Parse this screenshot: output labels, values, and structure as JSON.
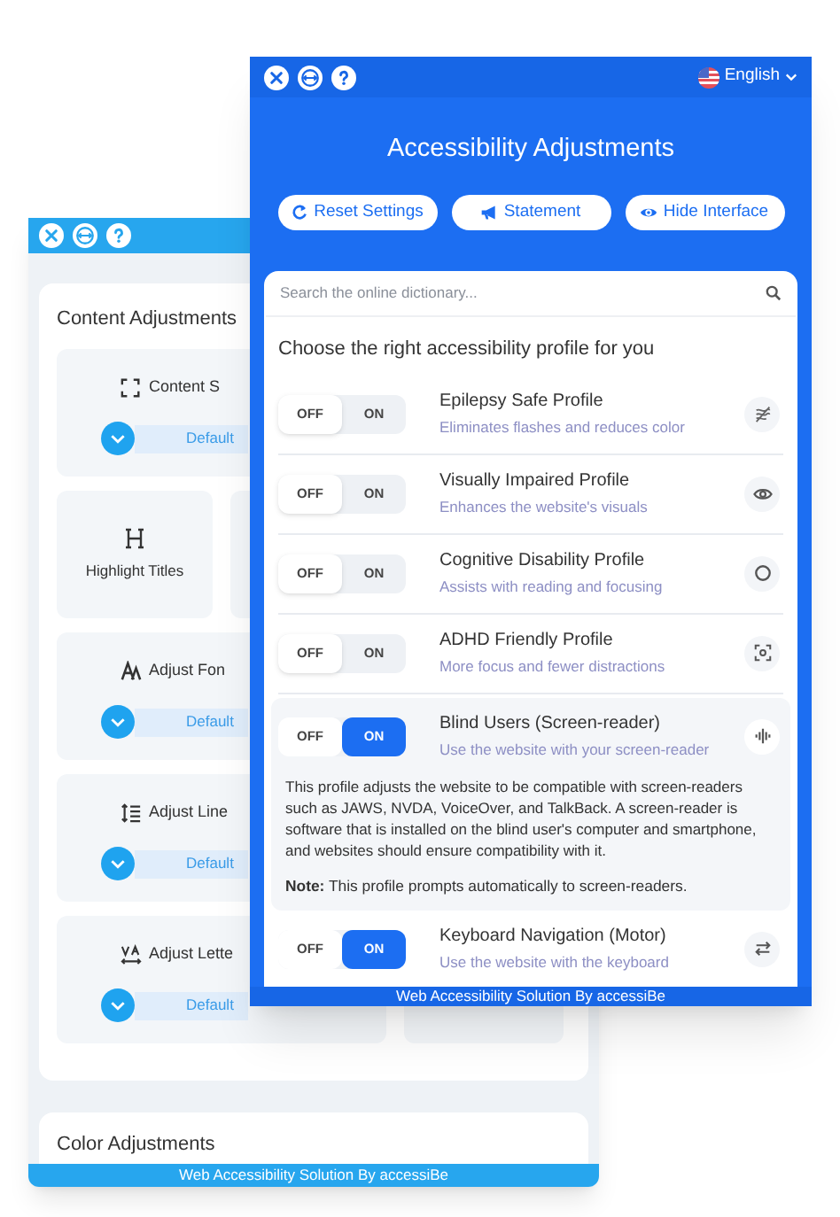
{
  "back_window": {
    "section_title": "Content Adjustments",
    "tiles": [
      {
        "kind": "stepper",
        "label": "Content S",
        "value": "Default"
      },
      {
        "kind": "toggle",
        "label": "Highlight Titles"
      },
      {
        "kind": "stepper",
        "label": "Adjust Fon",
        "value": "Default"
      },
      {
        "kind": "stepper",
        "label": "Adjust Line",
        "value": "Default"
      },
      {
        "kind": "stepper",
        "label": "Adjust Lette",
        "value": "Default"
      }
    ],
    "next_section_title": "Color Adjustments",
    "footer": "Web Accessibility Solution By accessiBe"
  },
  "front_window": {
    "language": "English",
    "title": "Accessibility Adjustments",
    "buttons": [
      "Reset Settings",
      "Statement",
      "Hide Interface"
    ],
    "search": {
      "placeholder": "Search the online dictionary..."
    },
    "profiles_heading": "Choose the right accessibility profile for you",
    "profiles": [
      {
        "off_label": "OFF",
        "on_label": "ON",
        "name": "Epilepsy Safe Profile",
        "description": "Eliminates flashes and reduces color",
        "on": false
      },
      {
        "off_label": "OFF",
        "on_label": "ON",
        "name": "Visually Impaired Profile",
        "description": "Enhances the website's visuals",
        "on": false
      },
      {
        "off_label": "OFF",
        "on_label": "ON",
        "name": "Cognitive Disability Profile",
        "description": "Assists with reading and focusing",
        "on": false
      },
      {
        "off_label": "OFF",
        "on_label": "ON",
        "name": "ADHD Friendly Profile",
        "description": "More focus and fewer distractions",
        "on": false
      },
      {
        "off_label": "OFF",
        "on_label": "ON",
        "name": "Blind Users (Screen-reader)",
        "description": "Use the website with your screen-reader",
        "on": true,
        "expanded": true,
        "details": "This profile adjusts the website to be compatible with screen-readers such as JAWS, NVDA, VoiceOver, and TalkBack. A screen-reader is software that is installed on the blind user's computer and smartphone, and websites should ensure compatibility with it.",
        "note": "**Note:** This profile prompts automatically to screen-readers."
      },
      {
        "off_label": "OFF",
        "on_label": "ON",
        "name": "Keyboard Navigation (Motor)",
        "description": "Use the website with the keyboard",
        "on": true,
        "expanded": false
      }
    ],
    "footer": "Web Accessibility Solution By accessiBe"
  }
}
